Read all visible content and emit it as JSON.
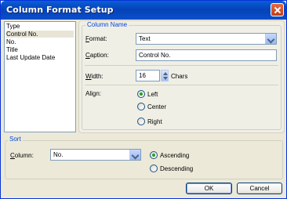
{
  "window": {
    "title": "Column Format Setup"
  },
  "columns_list": {
    "items": [
      "Type",
      "Control No.",
      "No.",
      "Title",
      "Last Update Date"
    ],
    "selected_index": 1
  },
  "column_name_group": {
    "legend": "Column Name",
    "format": {
      "label_u": "F",
      "label_rest": "ormat:",
      "value": "Text"
    },
    "caption": {
      "label_u": "C",
      "label_rest": "aption:",
      "value": "Control No."
    },
    "width": {
      "label_u": "W",
      "label_rest": "idth:",
      "value": "16",
      "unit": "Chars"
    },
    "align": {
      "label": "Align:",
      "options": [
        "Left",
        "Center",
        "Right"
      ],
      "selected": "Left"
    }
  },
  "sort_group": {
    "legend": "Sort",
    "column": {
      "label_u": "C",
      "label_rest": "olumn:",
      "value": "No."
    },
    "order": {
      "options": [
        "Ascending",
        "Descending"
      ],
      "selected": "Ascending"
    }
  },
  "buttons": {
    "ok": "OK",
    "cancel": "Cancel"
  },
  "colors": {
    "title_bar": "#0542b8",
    "legend_text": "#0046d5",
    "radio_dot": "#21a121"
  }
}
